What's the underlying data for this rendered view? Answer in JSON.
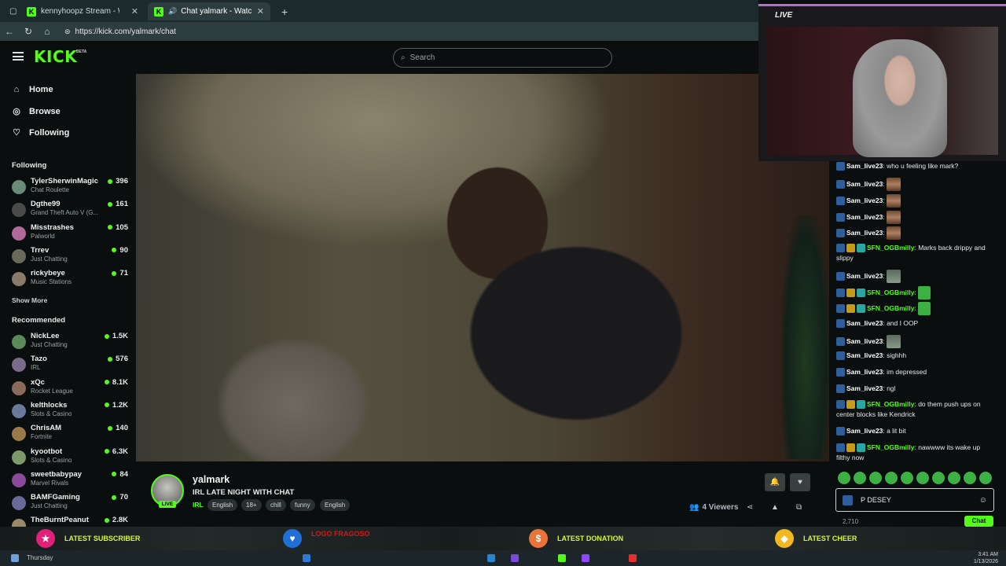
{
  "browser": {
    "tabs": [
      {
        "label": "kennyhoopz Stream - Watch Live on Kick",
        "active": false
      },
      {
        "label": "Chat yalmark - Watch Live on Kick",
        "active": true
      }
    ],
    "url": "https://kick.com/yalmark/chat"
  },
  "header": {
    "logo": "KICK",
    "logo_badge": "BETA",
    "search_placeholder": "Search"
  },
  "sidebar": {
    "nav": [
      {
        "label": "Home",
        "icon": "home-icon"
      },
      {
        "label": "Browse",
        "icon": "compass-icon"
      },
      {
        "label": "Following",
        "icon": "heart-icon"
      }
    ],
    "following_title": "Following",
    "following": [
      {
        "name": "TylerSherwinMagic",
        "category": "Chat Roulette",
        "viewers": "396"
      },
      {
        "name": "Dgthe99",
        "category": "Grand Theft Auto V (G...",
        "viewers": "161"
      },
      {
        "name": "Misstrashes",
        "category": "Palworld",
        "viewers": "105"
      },
      {
        "name": "Trrev",
        "category": "Just Chatting",
        "viewers": "90"
      },
      {
        "name": "rickybeye",
        "category": "Music Stations",
        "viewers": "71"
      }
    ],
    "show_more": "Show More",
    "recommended_title": "Recommended",
    "recommended": [
      {
        "name": "NickLee",
        "category": "Just Chatting",
        "viewers": "1.5K"
      },
      {
        "name": "Tazo",
        "category": "IRL",
        "viewers": "576"
      },
      {
        "name": "xQc",
        "category": "Rocket League",
        "viewers": "8.1K"
      },
      {
        "name": "kelthlocks",
        "category": "Slots & Casino",
        "viewers": "1.2K"
      },
      {
        "name": "ChrisAM",
        "category": "Fortnite",
        "viewers": "140"
      },
      {
        "name": "kyootbot",
        "category": "Slots & Casino",
        "viewers": "6.3K"
      },
      {
        "name": "sweetbabypay",
        "category": "Marvel Rivals",
        "viewers": "84"
      },
      {
        "name": "BAMFGaming",
        "category": "Just Chatting",
        "viewers": "70"
      },
      {
        "name": "TheBurntPeanut",
        "category": "",
        "viewers": "2.8K"
      }
    ]
  },
  "stream": {
    "live_badge": "LIVE",
    "streamer": "yalmark",
    "title": "IRL LATE NIGHT WITH CHAT",
    "category": "IRL",
    "tags": [
      "English",
      "18+",
      "chill",
      "funny",
      "English"
    ],
    "viewers": "4 Viewers"
  },
  "camera": {
    "label": "LIVE"
  },
  "chat": {
    "messages": [
      {
        "user": "Sam_live23",
        "badges": [
          "kick"
        ],
        "text": "who u feeling like mark?",
        "user_color": "#ffffff"
      },
      {
        "user": "Sam_live23",
        "badges": [
          "kick"
        ],
        "text": "",
        "emote": "face",
        "user_color": "#ffffff"
      },
      {
        "user": "Sam_live23",
        "badges": [
          "kick"
        ],
        "text": "",
        "emote": "face",
        "user_color": "#ffffff"
      },
      {
        "user": "Sam_live23",
        "badges": [
          "kick"
        ],
        "text": "",
        "emote": "face",
        "user_color": "#ffffff"
      },
      {
        "user": "Sam_live23",
        "badges": [
          "kick"
        ],
        "text": "",
        "emote": "face",
        "user_color": "#ffffff"
      },
      {
        "user": "SFN_OGBmilly",
        "badges": [
          "kick",
          "crown",
          "sub"
        ],
        "text": "Marks back drippy and slippy",
        "user_color": "#53fc18"
      },
      {
        "user": "Sam_live23",
        "badges": [
          "kick"
        ],
        "text": "",
        "emote": "cat",
        "user_color": "#ffffff"
      },
      {
        "user": "SFN_OGBmilly",
        "badges": [
          "kick",
          "crown",
          "sub"
        ],
        "text": "",
        "emote": "pepe",
        "user_color": "#53fc18"
      },
      {
        "user": "SFN_OGBmilly",
        "badges": [
          "kick",
          "crown",
          "sub"
        ],
        "text": "",
        "emote": "pepe",
        "user_color": "#53fc18"
      },
      {
        "user": "Sam_live23",
        "badges": [
          "kick"
        ],
        "text": "and I OOP",
        "user_color": "#ffffff"
      },
      {
        "user": "Sam_live23",
        "badges": [
          "kick"
        ],
        "text": "",
        "emote": "cat",
        "user_color": "#ffffff"
      },
      {
        "user": "Sam_live23",
        "badges": [
          "kick"
        ],
        "text": "sighhh",
        "user_color": "#ffffff"
      },
      {
        "user": "Sam_live23",
        "badges": [
          "kick"
        ],
        "text": "im depressed",
        "user_color": "#ffffff"
      },
      {
        "user": "Sam_live23",
        "badges": [
          "kick"
        ],
        "text": "ngl",
        "user_color": "#ffffff"
      },
      {
        "user": "SFN_OGBmilly",
        "badges": [
          "kick",
          "crown",
          "sub"
        ],
        "text": "do them push ups on center blocks like Kendrick",
        "user_color": "#53fc18"
      },
      {
        "user": "Sam_live23",
        "badges": [
          "kick"
        ],
        "text": "a lit bit",
        "user_color": "#ffffff"
      },
      {
        "user": "SFN_OGBmilly",
        "badges": [
          "kick",
          "crown",
          "sub"
        ],
        "text": "nawwww its wake up filthy now",
        "user_color": "#53fc18"
      }
    ],
    "input_value": "P DESEY",
    "send_label": "Chat",
    "count": "2,710"
  },
  "overlay": {
    "subscriber_label": "LATEST SUBSCRIBER",
    "subscriber_name": "LOGO FRAGOSO",
    "donation_label": "LATEST DONATION",
    "cheer_label": "LATEST CHEER"
  },
  "taskbar": {
    "weather": "Thursday",
    "time": "3:41 AM",
    "date": "1/13/2026"
  },
  "colors": {
    "accent": "#53fc18",
    "background": "#0b0e0f",
    "overlay_text": "#d8f542"
  }
}
